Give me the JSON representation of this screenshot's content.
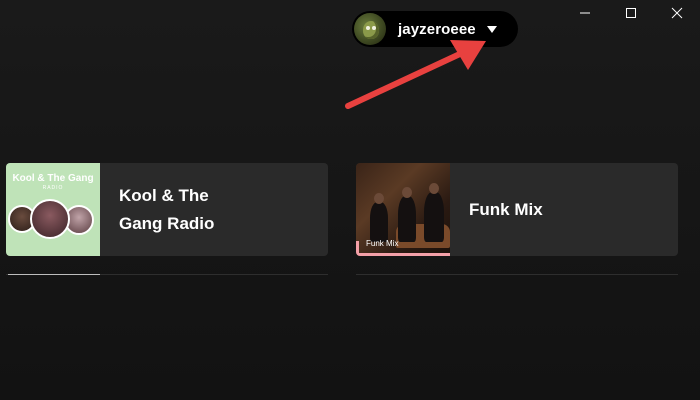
{
  "window": {
    "controls": [
      "minimize",
      "maximize",
      "close"
    ]
  },
  "user_menu": {
    "username": "jayzeroeee",
    "avatar_icon": "avatar-icon",
    "dropdown_icon": "caret-down-icon"
  },
  "annotation": {
    "type": "arrow",
    "color": "#e8413f",
    "points_to": "user_menu"
  },
  "shortcuts": [
    {
      "title": "Kool & The Gang Radio",
      "cover_title": "Kool & The Gang",
      "cover_subtitle": "RADIO",
      "cover_color": "#bfe3b8"
    },
    {
      "title": "Funk Mix",
      "cover_label": "Funk Mix",
      "accent_color": "#f4a0a8"
    }
  ],
  "colors": {
    "background": "#121212",
    "card": "#2a2a2a",
    "pill": "#000000",
    "text": "#ffffff"
  }
}
